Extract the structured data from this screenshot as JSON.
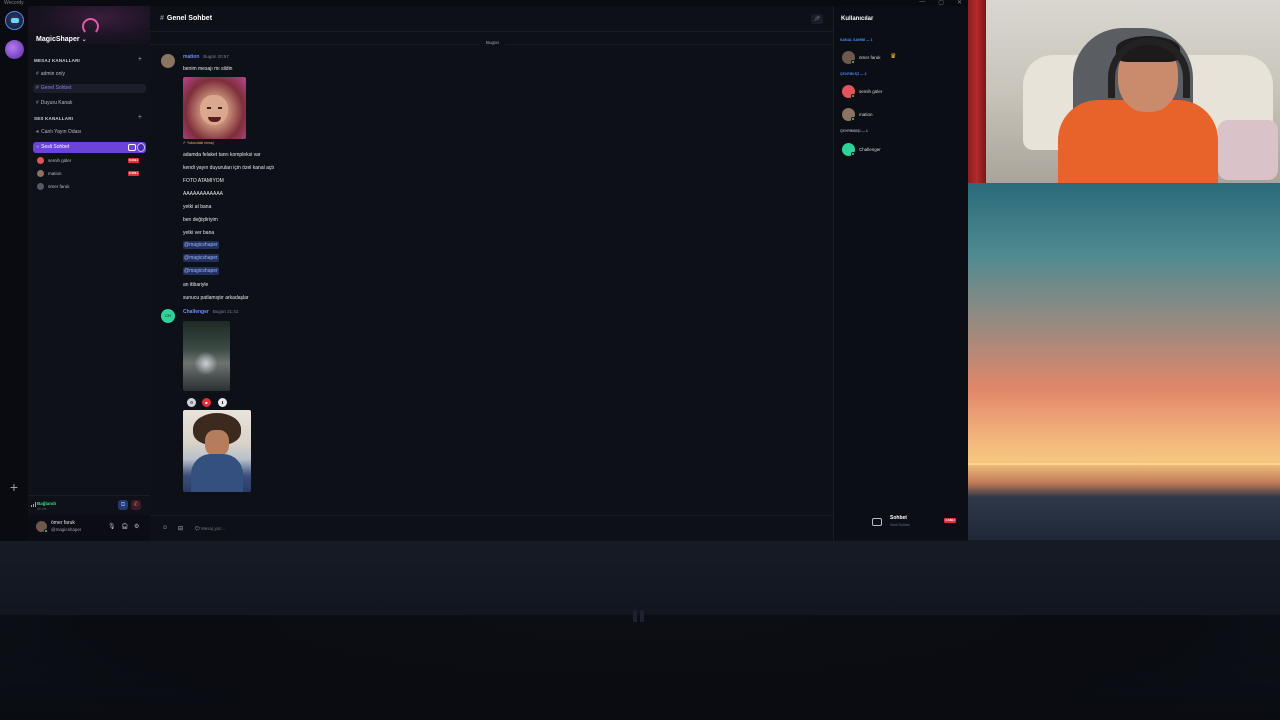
{
  "window": {
    "title": "Wecordy",
    "controls": [
      "—",
      "▢",
      "✕"
    ]
  },
  "server": {
    "name": "MagicShaper"
  },
  "channels": {
    "text_category": "MESAJ KANALLARI",
    "text_channels": [
      {
        "label": "admin only",
        "active": false
      },
      {
        "label": "Genel Sohbet",
        "active": true
      },
      {
        "label": "Duyuru Kanalı",
        "active": false
      }
    ],
    "voice_category": "SES KANALLARI",
    "voice_channels": [
      {
        "label": "Canlı Yayın Odası"
      },
      {
        "label": "Sesli Sohbet",
        "active": true
      }
    ],
    "voice_users": [
      {
        "name": "semih güler",
        "live": "CANLI",
        "color": "#e2535a"
      },
      {
        "name": "mation",
        "live": "CANLI",
        "color": "#8b7562"
      },
      {
        "name": "ömer faruk",
        "live": "",
        "color": "#555b66"
      }
    ]
  },
  "status": {
    "connection": "Bağlandı",
    "ping": "40 ms"
  },
  "user_panel": {
    "name": "ömer faruk",
    "tag": "@magicshaper"
  },
  "chat": {
    "channel_title": "Genel Sohbet",
    "day_divider": "Bugün",
    "composer_placeholder": "Mesaj yaz...",
    "messages": [
      {
        "author": "mation",
        "time": "Bugün 20:57",
        "lines": [
          "benim mesajı mı sildin"
        ],
        "reply_tag": "↱ Yukarıdaki mesaj",
        "lines_after_image": [
          "adamda felaket tanrı kompleksi var",
          "kendi yayın duyuruları için özel kanal açtı",
          "FOTO ATAMIYOM",
          "AAAAAAAAAAAA",
          "yetki at bana",
          "ben değiştiriyim",
          "yetki ver bana"
        ],
        "mentions": [
          "@magicshaper",
          "@magicshaper",
          "@magicshaper"
        ],
        "closing_lines": [
          "an itibariyle",
          "sunucu patlamıştır arkadaşlar"
        ]
      },
      {
        "author": "Challenger",
        "time": "Bugün 21:41",
        "avatar_initials": "CH"
      }
    ]
  },
  "members": {
    "title": "Kullanıcılar",
    "sections": [
      {
        "label": "KANAL SAHİBİ — 1",
        "color": "#4b8bf0"
      },
      {
        "label": "ÇEVRİM İÇİ — 3",
        "color": "#4b8bf0"
      },
      {
        "label": "ÇEVRİMDIŞI — 1",
        "color": "#9aa0ad"
      }
    ],
    "owner": "ömer faruk",
    "online": [
      "semih güler",
      "mation"
    ],
    "offline": [
      "Challenger"
    ],
    "voice_box": {
      "title": "Sohbet",
      "subtitle": "Sesli Sohbet",
      "live": "CANLI"
    }
  }
}
